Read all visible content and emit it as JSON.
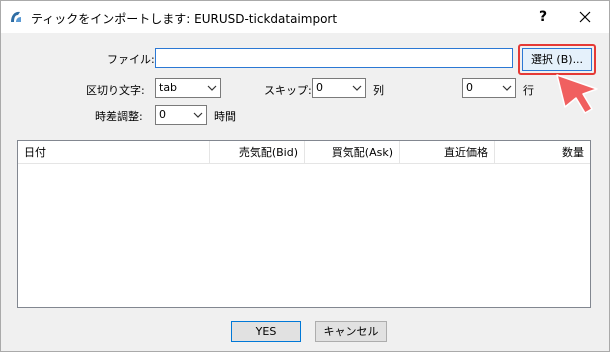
{
  "window": {
    "title": "ティックをインポートします: EURUSD-tickdataimport",
    "help_label": "?"
  },
  "form": {
    "file_label": "ファイル:",
    "file_value": "",
    "browse_label": "選択 (B)...",
    "delimiter_label": "区切り文字:",
    "delimiter_value": "tab",
    "skip_label": "スキップ:",
    "skip_cols_value": "0",
    "cols_unit": "列",
    "skip_rows_value": "0",
    "rows_unit": "行",
    "time_offset_label": "時差調整:",
    "time_offset_value": "0",
    "time_unit": "時間"
  },
  "table": {
    "columns": [
      "日付",
      "売気配(Bid)",
      "買気配(Ask)",
      "直近価格",
      "数量"
    ]
  },
  "buttons": {
    "yes_label": "YES",
    "cancel_label": "キャンセル"
  },
  "colors": {
    "highlight": "#e53935",
    "pointer": "#f06060",
    "accent": "#2b78d4"
  }
}
